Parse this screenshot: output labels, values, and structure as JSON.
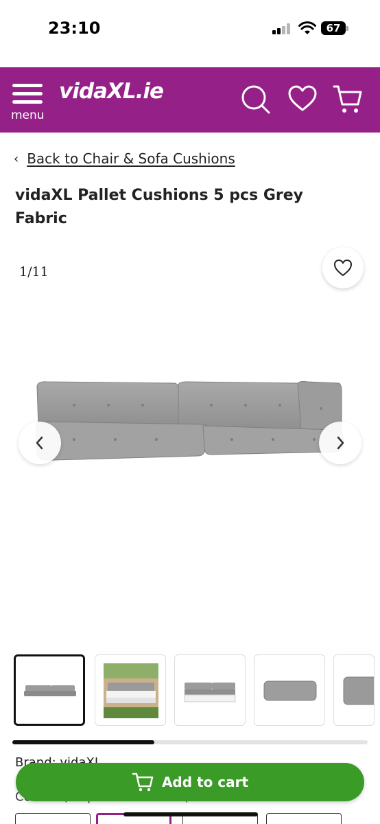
{
  "status_bar": {
    "time": "23:10",
    "battery": "67"
  },
  "header": {
    "menu_label": "menu",
    "logo_text": "vidaXL.ie",
    "background": "#952087",
    "icons": [
      "search-icon",
      "heart-icon",
      "cart-icon"
    ]
  },
  "breadcrumb": {
    "chevron": "‹",
    "label": "Back to Chair & Sofa Cushions"
  },
  "product": {
    "title": "vidaXL Pallet Cushions 5 pcs Grey Fabric",
    "image_counter": "1/11",
    "brand_line": "Brand: vidaXL",
    "colour_line": "Colour: (7 options available)"
  },
  "gallery": {
    "thumbnails": [
      "cushions-grey",
      "pallet-sofa-garden",
      "pallet-sofa-white",
      "single-cushion",
      "cushion-detail"
    ],
    "active_index": 0,
    "scroll_fraction": 0.4
  },
  "cart_button": {
    "label": "Add to cart",
    "color": "#3a9b27"
  }
}
